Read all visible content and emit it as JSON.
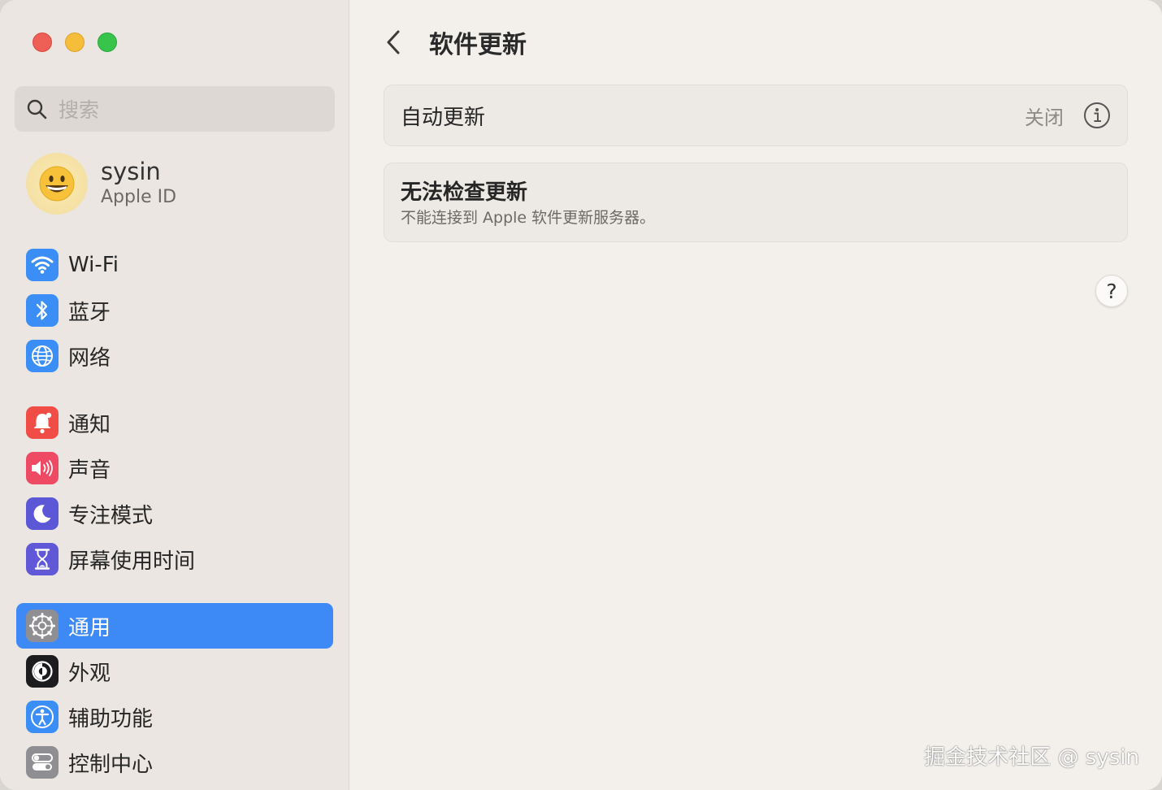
{
  "sidebar": {
    "search_placeholder": "搜索",
    "account": {
      "name": "sysin",
      "subtitle": "Apple ID",
      "avatar_icon": "grinning-face-icon"
    },
    "groups": [
      [
        {
          "label": "Wi-Fi",
          "icon": "wifi-icon",
          "color": "#3a8ef6"
        },
        {
          "label": "蓝牙",
          "icon": "bluetooth-icon",
          "color": "#3a8ef6"
        },
        {
          "label": "网络",
          "icon": "globe-icon",
          "color": "#3a8ef6"
        }
      ],
      [
        {
          "label": "通知",
          "icon": "bell-icon",
          "color": "#ef4d45"
        },
        {
          "label": "声音",
          "icon": "speaker-icon",
          "color": "#ee4a64"
        },
        {
          "label": "专注模式",
          "icon": "moon-icon",
          "color": "#5b57d6"
        },
        {
          "label": "屏幕使用时间",
          "icon": "hourglass-icon",
          "color": "#6158d8"
        }
      ],
      [
        {
          "label": "通用",
          "icon": "gear-icon",
          "color": "#8e8e93",
          "active": true
        },
        {
          "label": "外观",
          "icon": "appearance-icon",
          "color": "#1c1c1e"
        },
        {
          "label": "辅助功能",
          "icon": "accessibility-icon",
          "color": "#3a8ef6"
        },
        {
          "label": "控制中心",
          "icon": "control-center-icon",
          "color": "#8e8e93"
        }
      ]
    ]
  },
  "main": {
    "title": "软件更新",
    "auto_update": {
      "label": "自动更新",
      "value": "关闭"
    },
    "error": {
      "title": "无法检查更新",
      "description": "不能连接到 Apple 软件更新服务器。"
    },
    "help_label": "?"
  },
  "watermark": "掘金技术社区 @ sysin",
  "colors": {
    "accent": "#3d8af7",
    "sidebar_bg": "#ebe6e1",
    "main_bg": "#f3f0ec"
  }
}
